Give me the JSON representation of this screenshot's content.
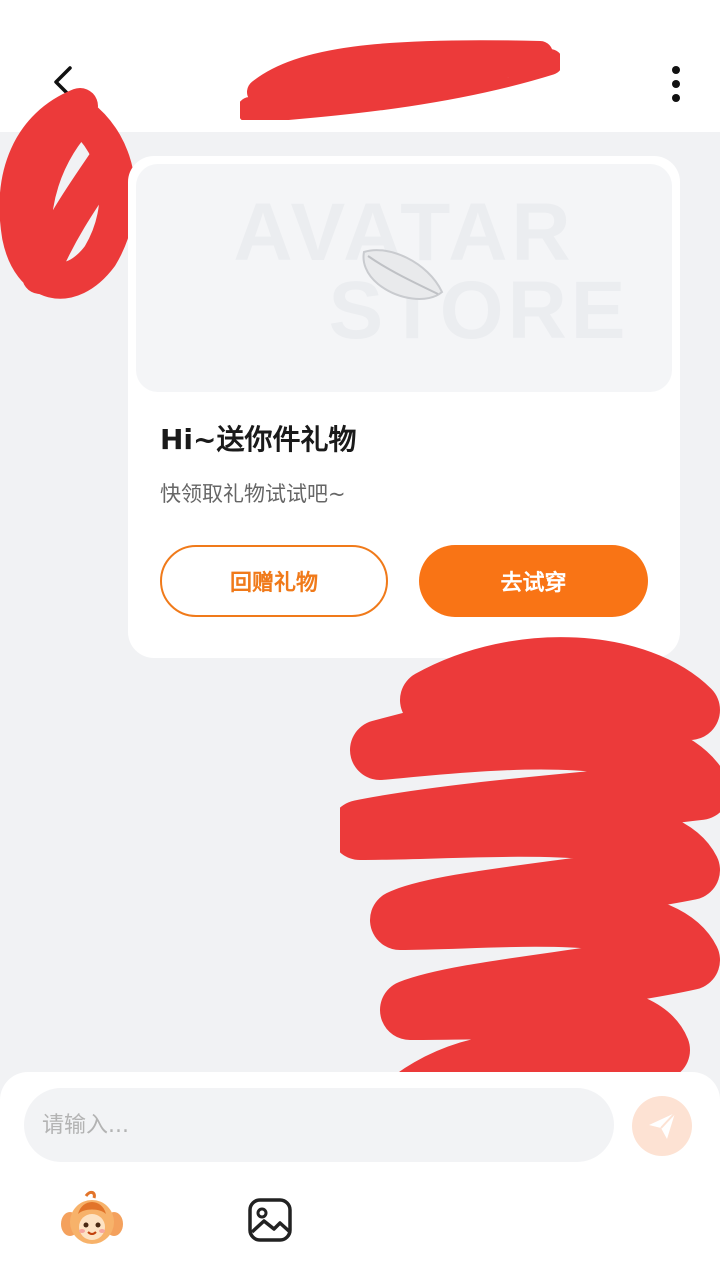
{
  "header": {
    "back_icon": "chevron-left-icon",
    "more_icon": "more-vertical-icon"
  },
  "card": {
    "banner_text_line1": "AVATAR",
    "banner_text_line2": "STORE",
    "title": "Hi~送你件礼物",
    "subtitle": "快领取礼物试试吧~",
    "return_gift_label": "回赠礼物",
    "try_on_label": "去试穿"
  },
  "composer": {
    "placeholder": "请输入...",
    "send_icon": "send-icon",
    "emoji_icon": "character-emoji-icon",
    "image_icon": "image-icon"
  },
  "colors": {
    "accent": "#f97415",
    "redaction": "#ec3a3a",
    "background": "#f1f2f4"
  }
}
